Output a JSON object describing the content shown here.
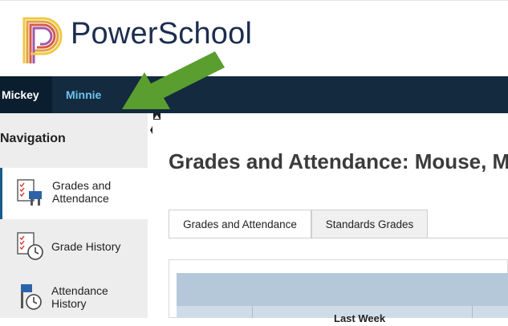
{
  "header": {
    "brand": "PowerSchool",
    "logo_icon": "powerschool-logo-icon"
  },
  "students": {
    "active": "Mickey",
    "other": "Minnie"
  },
  "navigation": {
    "title": "Navigation",
    "items": [
      {
        "label_line1": "Grades and",
        "label_line2": "Attendance",
        "icon": "grades-attendance-icon",
        "active": true
      },
      {
        "label_line1": "Grade History",
        "label_line2": "",
        "icon": "grade-history-icon",
        "active": false
      },
      {
        "label_line1": "Attendance",
        "label_line2": "History",
        "icon": "attendance-history-icon",
        "active": false
      }
    ]
  },
  "main": {
    "title": "Grades and Attendance: Mouse, Mi",
    "tabs": [
      {
        "label": "Grades and Attendance",
        "active": true
      },
      {
        "label": "Standards Grades",
        "active": false
      }
    ],
    "table": {
      "column_header": "Last Week"
    }
  },
  "colors": {
    "student_bar": "#132a3f",
    "student_other": "#6fc3ee",
    "sidebar_bg": "#ededed",
    "table_header": "#b5c8d9",
    "arrow": "#5a9e2f"
  }
}
